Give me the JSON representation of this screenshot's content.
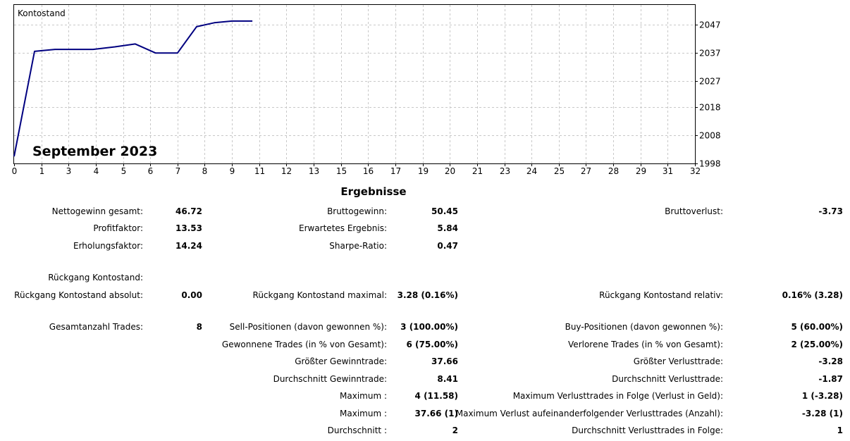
{
  "chart_data": {
    "type": "line",
    "title": "Kontostand",
    "subtitle": "September 2023",
    "x_ticks": [
      "0",
      "1",
      "3",
      "4",
      "5",
      "6",
      "7",
      "8",
      "9",
      "11",
      "12",
      "13",
      "15",
      "16",
      "17",
      "19",
      "20",
      "21",
      "23",
      "24",
      "25",
      "27",
      "28",
      "29",
      "31",
      "32"
    ],
    "y_ticks": [
      "1998",
      "2008",
      "2018",
      "2027",
      "2037",
      "2047"
    ],
    "ylim": [
      1998,
      2054
    ],
    "grid": true,
    "series": [
      {
        "color": "#000080",
        "x": [
          0,
          0.75,
          1.5,
          2.9,
          3.7,
          4.45,
          5.2,
          6.0,
          6.7,
          7.35,
          8.0,
          8.75
        ],
        "y": [
          2000.5,
          2037.6,
          2038.3,
          2038.3,
          2039.2,
          2040.2,
          2037.0,
          2037.0,
          2046.3,
          2047.7,
          2048.3,
          2048.3
        ]
      }
    ]
  },
  "results": {
    "title": "Ergebnisse",
    "rows": [
      {
        "cells": [
          [
            "Nettogewinn gesamt:",
            "46.72"
          ],
          [
            "Bruttogewinn:",
            "50.45"
          ],
          [
            "Bruttoverlust:",
            "-3.73"
          ]
        ]
      },
      {
        "cells": [
          [
            "Profitfaktor:",
            "13.53"
          ],
          [
            "Erwartetes Ergebnis:",
            "5.84"
          ],
          [
            "",
            ""
          ]
        ]
      },
      {
        "cells": [
          [
            "Erholungsfaktor:",
            "14.24"
          ],
          [
            "Sharpe-Ratio:",
            "0.47"
          ],
          [
            "",
            ""
          ]
        ]
      },
      {
        "cells": [
          [
            "Rückgang Kontostand:",
            ""
          ],
          [
            "",
            ""
          ],
          [
            "",
            ""
          ]
        ]
      },
      {
        "cells": [
          [
            "Rückgang Kontostand absolut:",
            "0.00"
          ],
          [
            "Rückgang Kontostand maximal:",
            "3.28 (0.16%)"
          ],
          [
            "Rückgang Kontostand relativ:",
            "0.16% (3.28)"
          ]
        ]
      },
      {
        "cells": [
          [
            "Gesamtanzahl Trades:",
            "8"
          ],
          [
            "Sell-Positionen (davon gewonnen %):",
            "3 (100.00%)"
          ],
          [
            "Buy-Positionen (davon gewonnen %):",
            "5 (60.00%)"
          ]
        ]
      },
      {
        "cells": [
          [
            "",
            ""
          ],
          [
            "Gewonnene Trades (in % von Gesamt):",
            "6 (75.00%)"
          ],
          [
            "Verlorene Trades (in % von Gesamt):",
            "2 (25.00%)"
          ]
        ]
      },
      {
        "cells": [
          [
            "",
            ""
          ],
          [
            "Größter Gewinntrade:",
            "37.66"
          ],
          [
            "Größter Verlusttrade:",
            "-3.28"
          ]
        ]
      },
      {
        "cells": [
          [
            "",
            ""
          ],
          [
            "Durchschnitt Gewinntrade:",
            "8.41"
          ],
          [
            "Durchschnitt Verlusttrade:",
            "-1.87"
          ]
        ]
      },
      {
        "cells": [
          [
            "",
            ""
          ],
          [
            "Maximum :",
            "4 (11.58)"
          ],
          [
            "Maximum Verlusttrades in Folge (Verlust in Geld):",
            "1 (-3.28)"
          ]
        ]
      },
      {
        "cells": [
          [
            "",
            ""
          ],
          [
            "Maximum :",
            "37.66 (1)"
          ],
          [
            "Maximum Verlust aufeinanderfolgender Verlusttrades (Anzahl):",
            "-3.28 (1)"
          ]
        ]
      },
      {
        "cells": [
          [
            "",
            ""
          ],
          [
            "Durchschnitt :",
            "2"
          ],
          [
            "Durchschnitt Verlusttrades in Folge:",
            "1"
          ]
        ]
      }
    ]
  }
}
